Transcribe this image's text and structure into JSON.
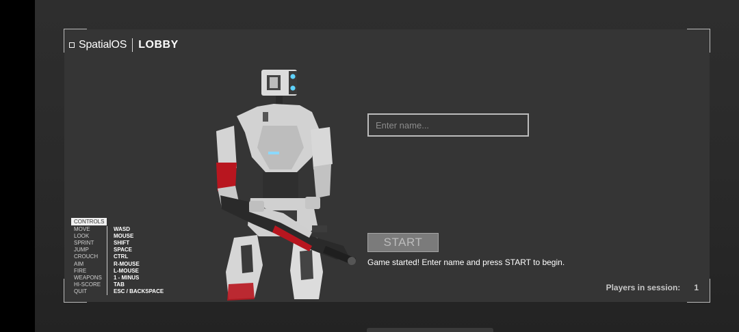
{
  "header": {
    "brand": "SpatialOS",
    "title": "LOBBY"
  },
  "name_input": {
    "value": "",
    "placeholder": "Enter name..."
  },
  "start_button": {
    "label": "START",
    "enabled": false
  },
  "status_message": "Game started! Enter name and press START to begin.",
  "controls": {
    "header": "CONTROLS",
    "items": [
      {
        "action": "MOVE",
        "key": "WASD"
      },
      {
        "action": "LOOK",
        "key": "MOUSE"
      },
      {
        "action": "SPRINT",
        "key": "SHIFT"
      },
      {
        "action": "JUMP",
        "key": "SPACE"
      },
      {
        "action": "CROUCH",
        "key": "CTRL"
      },
      {
        "action": "AIM",
        "key": "R-MOUSE"
      },
      {
        "action": "FIRE",
        "key": "L-MOUSE"
      },
      {
        "action": "WEAPONS",
        "key": "1 - MINUS"
      },
      {
        "action": "HI-SCORE",
        "key": "TAB"
      },
      {
        "action": "QUIT",
        "key": "ESC / BACKSPACE"
      }
    ]
  },
  "players": {
    "label": "Players in session:",
    "count": "1"
  },
  "colors": {
    "panel": "#353535",
    "frame": "#bdbdbd",
    "accent_red": "#b8161f",
    "eye_glow": "#5fd3ff"
  }
}
